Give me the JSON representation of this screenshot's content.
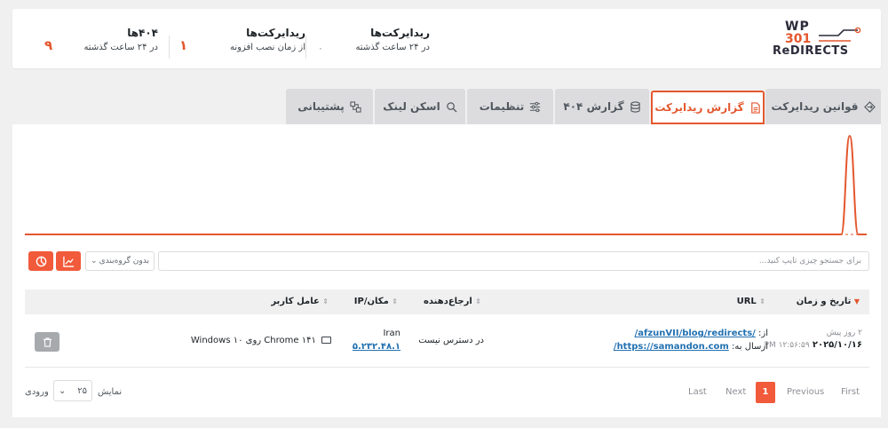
{
  "brand": {
    "line1": "WP",
    "line2": "301",
    "line3": "ReDIRECTS"
  },
  "stats": [
    {
      "title": "ریدایرکت‌ها",
      "subtitle": "در ۲۴ ساعت گذشته",
      "value": "۰"
    },
    {
      "title": "ریدایرکت‌ها",
      "subtitle": "از زمان نصب افزونه",
      "value": "۱"
    },
    {
      "title": "۴۰۴‌ها",
      "subtitle": "در ۲۴ ساعت گذشته",
      "value": "۹"
    }
  ],
  "tabs": [
    {
      "label": "قوانین ریدایرکت",
      "icon": "redirect-icon"
    },
    {
      "label": "گزارش ریدایرکت",
      "icon": "document-icon",
      "active": true
    },
    {
      "label": "گزارش ۴۰۴",
      "icon": "database-icon"
    },
    {
      "label": "تنظیمات",
      "icon": "sliders-icon"
    },
    {
      "label": "اسکن لینک",
      "icon": "search-icon"
    },
    {
      "label": "پشتیبانی",
      "icon": "support-icon"
    }
  ],
  "accent": "#e4572e",
  "chart_data": {
    "type": "line",
    "series": [
      {
        "values": [
          0,
          0,
          0,
          0,
          0,
          0,
          0,
          0,
          0,
          0,
          0,
          0,
          0,
          0,
          0,
          0,
          0,
          0,
          0,
          0,
          0,
          0,
          0,
          0,
          0,
          0,
          0,
          0,
          0,
          0,
          0,
          0,
          0,
          0,
          0,
          0,
          0,
          0,
          0,
          0,
          0,
          0,
          0,
          0,
          0,
          0,
          0,
          0,
          0,
          0,
          0,
          0,
          0,
          0,
          0,
          0,
          0,
          0,
          0,
          0,
          0,
          0,
          0,
          0,
          0,
          0,
          0,
          0,
          0,
          0,
          0,
          0,
          0,
          0,
          0,
          0,
          0,
          0,
          0,
          0,
          0,
          0,
          0,
          0,
          0,
          0,
          0,
          0,
          0,
          0,
          0,
          0,
          0,
          0,
          0,
          0,
          0,
          1,
          0,
          0
        ]
      }
    ],
    "grid": false
  },
  "toolbar": {
    "search_placeholder": "برای جستجو چیزی تایپ کنید...",
    "group_label": "بدون گروه‌بندی",
    "chart_button_icon": "chart-icon",
    "pie_button_icon": "pie-icon"
  },
  "table": {
    "columns": [
      "تاریخ و زمان",
      "URL",
      "ارجاع‌دهنده",
      "مکان/IP",
      "عامل کاربر"
    ],
    "rows": [
      {
        "date_relative": "۲ روز پیش",
        "date": "۲۰۲۵/۱۰/۱۶",
        "time": "PM ۱۲:۵۶:۵۹",
        "from_label": "از:",
        "from_url": "/afzunVII/blog/redirects/",
        "to_label": "ارسال به:",
        "to_url": "https://samandon.com/",
        "referrer": "در دسترس نیست",
        "country": "Iran",
        "ip": "۵.۲۳۲.۴۸.۱",
        "agent": "Chrome ۱۴۱ روی Windows ۱۰",
        "delete_icon": "trash-icon"
      }
    ]
  },
  "pagination": {
    "first": "First",
    "previous": "Previous",
    "current": "1",
    "next": "Next",
    "last": "Last",
    "show_label": "نمایش",
    "per_page": "۲۵",
    "entries_label": "ورودی"
  }
}
